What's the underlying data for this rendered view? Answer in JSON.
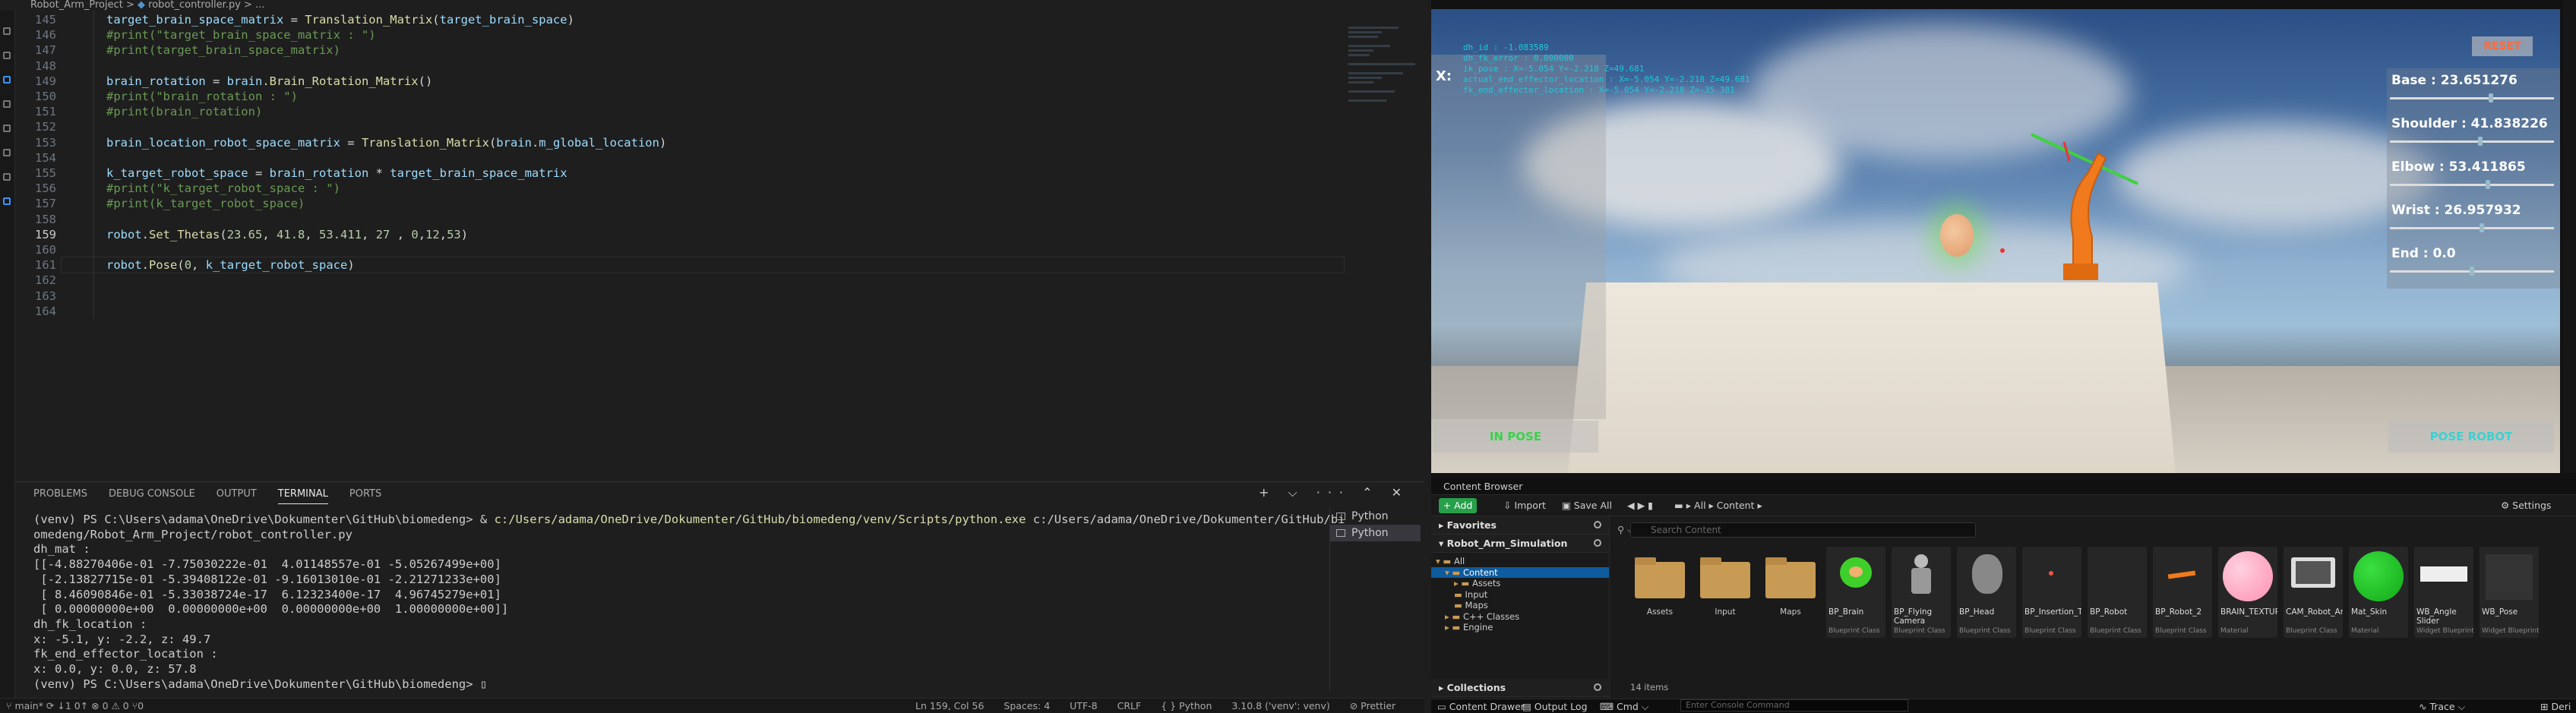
{
  "breadcrumb": {
    "project": "Robot_Arm_Project",
    "file": "robot_controller.py",
    "rest": "..."
  },
  "editor": {
    "current_line": 159,
    "lines": [
      {
        "n": "145",
        "tokens": [
          [
            "v",
            "target_brain_space_matrix"
          ],
          [
            "p",
            " = "
          ],
          [
            "f",
            "Translation_Matrix"
          ],
          [
            "p",
            "("
          ],
          [
            "v",
            "target_brain_space"
          ],
          [
            "p",
            ")"
          ]
        ]
      },
      {
        "n": "146",
        "tokens": [
          [
            "c",
            "#print(\"target_brain_space_matrix : \")"
          ]
        ]
      },
      {
        "n": "147",
        "tokens": [
          [
            "c",
            "#print(target_brain_space_matrix)"
          ]
        ]
      },
      {
        "n": "148",
        "tokens": []
      },
      {
        "n": "149",
        "tokens": [
          [
            "v",
            "brain_rotation"
          ],
          [
            "p",
            " = "
          ],
          [
            "v",
            "brain"
          ],
          [
            "p",
            "."
          ],
          [
            "f",
            "Brain_Rotation_Matrix"
          ],
          [
            "p",
            "()"
          ]
        ]
      },
      {
        "n": "150",
        "tokens": [
          [
            "c",
            "#print(\"brain_rotation : \")"
          ]
        ]
      },
      {
        "n": "151",
        "tokens": [
          [
            "c",
            "#print(brain_rotation)"
          ]
        ]
      },
      {
        "n": "152",
        "tokens": []
      },
      {
        "n": "153",
        "tokens": [
          [
            "v",
            "brain_location_robot_space_matrix"
          ],
          [
            "p",
            " = "
          ],
          [
            "f",
            "Translation_Matrix"
          ],
          [
            "p",
            "("
          ],
          [
            "v",
            "brain"
          ],
          [
            "p",
            "."
          ],
          [
            "v",
            "m_global_location"
          ],
          [
            "p",
            ")"
          ]
        ]
      },
      {
        "n": "154",
        "tokens": []
      },
      {
        "n": "155",
        "tokens": [
          [
            "v",
            "k_target_robot_space"
          ],
          [
            "p",
            " = "
          ],
          [
            "v",
            "brain_rotation"
          ],
          [
            "p",
            " * "
          ],
          [
            "v",
            "target_brain_space_matrix"
          ]
        ]
      },
      {
        "n": "156",
        "tokens": [
          [
            "c",
            "#print(\"k_target_robot_space : \")"
          ]
        ]
      },
      {
        "n": "157",
        "tokens": [
          [
            "c",
            "#print(k_target_robot_space)"
          ]
        ]
      },
      {
        "n": "158",
        "tokens": []
      },
      {
        "n": "159",
        "tokens": [
          [
            "v",
            "robot"
          ],
          [
            "p",
            "."
          ],
          [
            "f",
            "Set_Thetas"
          ],
          [
            "p",
            "("
          ],
          [
            "n",
            "23.65"
          ],
          [
            "p",
            ", "
          ],
          [
            "n",
            "41.8"
          ],
          [
            "p",
            ", "
          ],
          [
            "n",
            "53.411"
          ],
          [
            "p",
            ", "
          ],
          [
            "n",
            "27"
          ],
          [
            "p",
            " , "
          ],
          [
            "n",
            "0"
          ],
          [
            "p",
            ","
          ],
          [
            "n",
            "12"
          ],
          [
            "p",
            ","
          ],
          [
            "n",
            "53"
          ],
          [
            "p",
            ")"
          ]
        ]
      },
      {
        "n": "160",
        "tokens": []
      },
      {
        "n": "161",
        "tokens": [
          [
            "v",
            "robot"
          ],
          [
            "p",
            "."
          ],
          [
            "f",
            "Pose"
          ],
          [
            "p",
            "("
          ],
          [
            "n",
            "0"
          ],
          [
            "p",
            ", "
          ],
          [
            "v",
            "k_target_robot_space"
          ],
          [
            "p",
            ")"
          ]
        ]
      },
      {
        "n": "162",
        "tokens": []
      },
      {
        "n": "163",
        "tokens": []
      },
      {
        "n": "164",
        "tokens": []
      }
    ]
  },
  "panel": {
    "tabs": [
      "PROBLEMS",
      "DEBUG CONSOLE",
      "OUTPUT",
      "TERMINAL",
      "PORTS"
    ],
    "active_tab": "TERMINAL",
    "controls": "+ ⌵ ··· ⌃ ✕",
    "terminals": [
      "Python",
      "Python"
    ],
    "terminal_lines": [
      {
        "prefix": "(venv) PS C:\\Users\\adama\\OneDrive\\Dokumenter\\GitHub\\biomedeng> & ",
        "path": "c:/Users/adama/OneDrive/Dokumenter/GitHub/biomedeng/venv/Scripts/python.exe",
        "suffix": " c:/Users/adama/OneDrive/Dokumenter/GitHub/bi"
      },
      {
        "prefix": "omedeng/Robot_Arm_Project/robot_controller.py",
        "path": "",
        "suffix": ""
      },
      {
        "prefix": "dh_mat :",
        "path": "",
        "suffix": ""
      },
      {
        "prefix": "[[-4.88270406e-01 -7.75030222e-01  4.01148557e-01 -5.05267499e+00]",
        "path": "",
        "suffix": ""
      },
      {
        "prefix": " [-2.13827715e-01 -5.39408122e-01 -9.16013010e-01 -2.21271233e+00]",
        "path": "",
        "suffix": ""
      },
      {
        "prefix": " [ 8.46090846e-01 -5.33038724e-17  6.12323400e-17  4.96745279e+01]",
        "path": "",
        "suffix": ""
      },
      {
        "prefix": " [ 0.00000000e+00  0.00000000e+00  0.00000000e+00  1.00000000e+00]]",
        "path": "",
        "suffix": ""
      },
      {
        "prefix": "dh_fk_location :",
        "path": "",
        "suffix": ""
      },
      {
        "prefix": "x: -5.1, y: -2.2, z: 49.7",
        "path": "",
        "suffix": ""
      },
      {
        "prefix": "fk_end_effector_location :",
        "path": "",
        "suffix": ""
      },
      {
        "prefix": "x: 0.0, y: 0.0, z: 57.8",
        "path": "",
        "suffix": ""
      },
      {
        "prefix": "(venv) PS C:\\Users\\adama\\OneDrive\\Dokumenter\\GitHub\\biomedeng> ▯",
        "path": "",
        "suffix": ""
      }
    ]
  },
  "status": {
    "left": "⑂ main*  ⟳ ↓1 0↑  ⊗ 0 ⚠ 0   ⑂0",
    "items": [
      "Ln 159, Col 56",
      "Spaces: 4",
      "UTF-8",
      "CRLF",
      "{ } Python",
      "3.10.8 ('venv': venv)",
      "⊘ Prettier"
    ]
  },
  "viewport": {
    "x_label": "X:",
    "debug_lines": [
      "dh_id : -1.083589",
      "dh_fk_error : 0.000000",
      "ik_pose : X=-5.054 Y=-2.218 Z=49.681",
      "actual_end_effector_location : X=-5.054 Y=-2.218 Z=49.681",
      "fk_end_effector_location : X=-5.054 Y=-2.218 Z=-35.381"
    ],
    "reset_label": "RESET",
    "joints": [
      {
        "label": "Base : 23.651276",
        "level": 0.62
      },
      {
        "label": "Shoulder : 41.838226",
        "level": 0.55
      },
      {
        "label": "Elbow : 53.411865",
        "level": 0.6
      },
      {
        "label": "Wrist : 26.957932",
        "level": 0.56
      },
      {
        "label": "End : 0.0",
        "level": 0.5
      }
    ],
    "in_pose_label": "IN POSE",
    "pose_check_label": "POSE ROBOT"
  },
  "content_browser": {
    "tab": "Content Browser",
    "add_label": "+ Add",
    "import_label": "⇩ Import",
    "save_all_label": "▣ Save All",
    "path": [
      "All",
      "Content"
    ],
    "settings_label": "⚙ Settings",
    "favorites_label": "Favorites",
    "project_label": "Robot_Arm_Simulation",
    "tree": [
      "All",
      "Content",
      "Assets",
      "Input",
      "Maps",
      "C++ Classes",
      "Engine"
    ],
    "collections_label": "Collections",
    "search_placeholder": "Search Content",
    "items_count": "14 items",
    "assets": [
      {
        "name": "Assets",
        "type": "",
        "kind": "folder"
      },
      {
        "name": "Input",
        "type": "",
        "kind": "folder"
      },
      {
        "name": "Maps",
        "type": "",
        "kind": "folder"
      },
      {
        "name": "BP_Brain",
        "type": "Blueprint Class",
        "kind": "bp"
      },
      {
        "name": "BP_Flying Camera",
        "type": "Blueprint Class",
        "kind": "bp"
      },
      {
        "name": "BP_Head",
        "type": "Blueprint Class",
        "kind": "bp"
      },
      {
        "name": "BP_Insertion_Target",
        "type": "Blueprint Class",
        "kind": "bp"
      },
      {
        "name": "BP_Robot",
        "type": "Blueprint Class",
        "kind": "bp"
      },
      {
        "name": "BP_Robot_2",
        "type": "Blueprint Class",
        "kind": "bp"
      },
      {
        "name": "BRAIN_TEXTURE_...",
        "type": "Material",
        "kind": "bp"
      },
      {
        "name": "CAM_Robot_Arm_...",
        "type": "Blueprint Class",
        "kind": "bp"
      },
      {
        "name": "Mat_Skin",
        "type": "Material",
        "kind": "bp"
      },
      {
        "name": "WB_Angle Slider",
        "type": "Widget Blueprint",
        "kind": "bp"
      },
      {
        "name": "WB_Pose",
        "type": "Widget Blueprint",
        "kind": "bp"
      }
    ]
  },
  "ue_bottom": {
    "content_drawer": "▭ Content Drawer",
    "output_log": "▤ Output Log",
    "cmd": "⌨ Cmd ⌵",
    "console_placeholder": "Enter Console Command",
    "trace": "∿ Trace ⌵",
    "derived": "⊞ Deri"
  }
}
